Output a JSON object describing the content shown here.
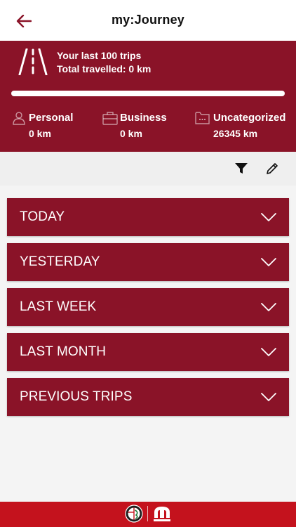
{
  "header": {
    "title": "my:Journey",
    "back_icon": "arrow-left-icon"
  },
  "summary": {
    "line1": "Your last 100 trips",
    "line2": "Total travelled: 0 km",
    "categories": [
      {
        "label": "Personal",
        "value": "0 km",
        "icon": "person-icon"
      },
      {
        "label": "Business",
        "value": "0 km",
        "icon": "briefcase-icon"
      },
      {
        "label": "Uncategorized",
        "value": "26345 km",
        "icon": "folder-icon"
      }
    ]
  },
  "toolbar": {
    "filter_icon": "filter-icon",
    "edit_icon": "pencil-icon"
  },
  "groups": [
    {
      "label": "TODAY"
    },
    {
      "label": "YESTERDAY"
    },
    {
      "label": "LAST WEEK"
    },
    {
      "label": "LAST MONTH"
    },
    {
      "label": "PREVIOUS TRIPS"
    }
  ],
  "colors": {
    "brand": "#8a1328",
    "footer": "#c4121d",
    "background": "#f4f4f4"
  }
}
